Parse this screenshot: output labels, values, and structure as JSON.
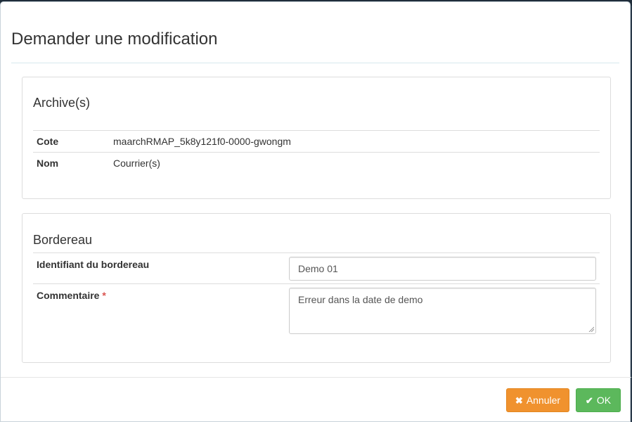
{
  "modal": {
    "title": "Demander une modification"
  },
  "archive_panel": {
    "heading": "Archive(s)",
    "rows": [
      {
        "label": "Cote",
        "value": "maarchRMAP_5k8y121f0-0000-gwongm"
      },
      {
        "label": "Nom",
        "value": "Courrier(s)"
      }
    ]
  },
  "bordereau_panel": {
    "heading": "Bordereau",
    "identifiant_label": "Identifiant du bordereau",
    "identifiant_value": "Demo 01",
    "commentaire_label": "Commentaire",
    "required_marker": "*",
    "commentaire_value": "Erreur dans la date de demo"
  },
  "footer": {
    "cancel_label": "Annuler",
    "cancel_icon": "times-icon",
    "ok_label": "OK",
    "ok_icon": "check-icon"
  },
  "colors": {
    "cancel": "#f0922e",
    "ok": "#5cb85c",
    "required": "#d9534f"
  }
}
